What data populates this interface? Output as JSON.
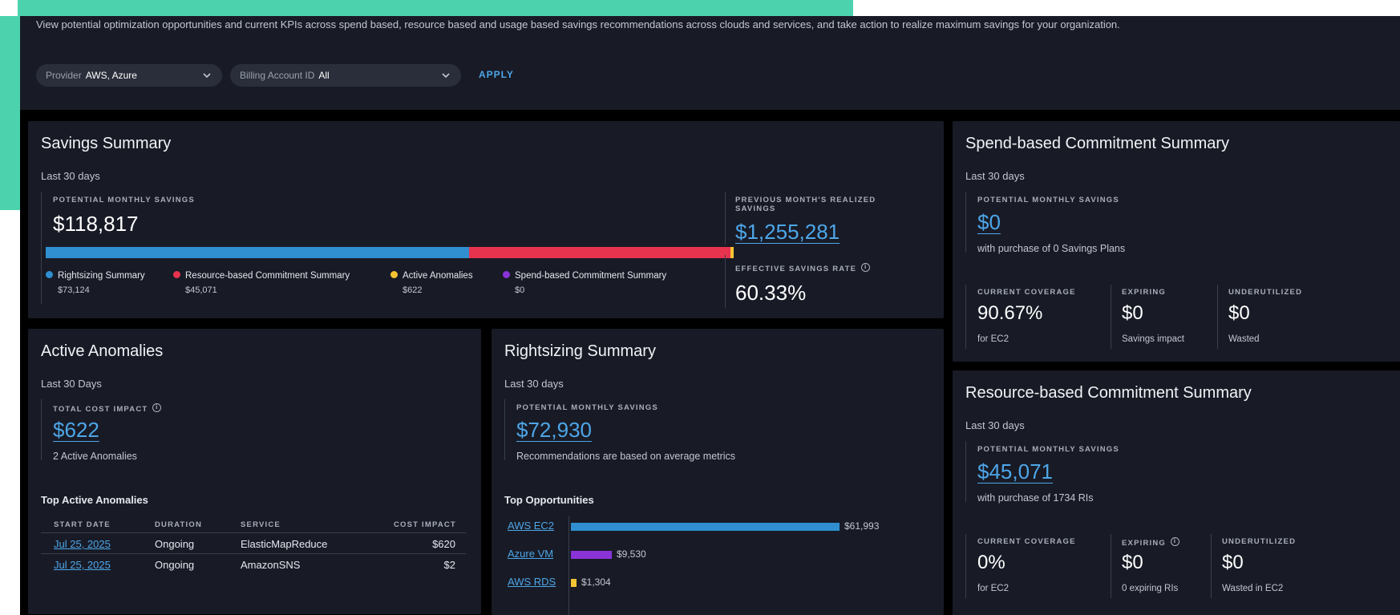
{
  "header": {
    "description": "View potential optimization opportunities and current KPIs across spend based, resource based and usage based savings recommendations across clouds and services, and take action to realize maximum savings for your organization.",
    "filters": [
      {
        "label": "Provider",
        "value": "AWS, Azure"
      },
      {
        "label": "Billing Account ID",
        "value": "All"
      }
    ],
    "apply_label": "APPLY"
  },
  "savings_summary": {
    "title": "Savings Summary",
    "period": "Last 30 days",
    "potential_label": "POTENTIAL MONTHLY SAVINGS",
    "potential_value": "$118,817",
    "breakdown_fractions": [
      0.614,
      0.379,
      0.005,
      0.0
    ],
    "legend": [
      {
        "label": "Rightsizing Summary",
        "value": "$73,124",
        "color": "#2f8fd0"
      },
      {
        "label": "Resource-based Commitment Summary",
        "value": "$45,071",
        "color": "#e8334f"
      },
      {
        "label": "Active Anomalies",
        "value": "$622",
        "color": "#f5c332"
      },
      {
        "label": "Spend-based Commitment Summary",
        "value": "$0",
        "color": "#8a33d6"
      }
    ],
    "previous_label": "PREVIOUS MONTH'S REALIZED SAVINGS",
    "previous_value": "$1,255,281",
    "rate_label": "EFFECTIVE SAVINGS RATE",
    "rate_value": "60.33%"
  },
  "spend_commitment": {
    "title": "Spend-based Commitment Summary",
    "period": "Last 30 days",
    "potential_label": "POTENTIAL MONTHLY SAVINGS",
    "potential_value": "$0",
    "potential_note": "with purchase of 0 Savings Plans",
    "coverage_label": "CURRENT COVERAGE",
    "coverage_value": "90.67%",
    "coverage_note": "for EC2",
    "expiring_label": "EXPIRING",
    "expiring_value": "$0",
    "expiring_note": "Savings impact",
    "under_label": "UNDERUTILIZED",
    "under_value": "$0",
    "under_note": "Wasted"
  },
  "anomalies": {
    "title": "Active Anomalies",
    "period": "Last 30 Days",
    "impact_label": "TOTAL COST IMPACT",
    "impact_value": "$622",
    "impact_note": "2 Active Anomalies",
    "top_label": "Top Active Anomalies",
    "columns": [
      "START DATE",
      "DURATION",
      "SERVICE",
      "COST IMPACT"
    ],
    "rows": [
      {
        "date": "Jul 25, 2025",
        "duration": "Ongoing",
        "service": "ElasticMapReduce",
        "impact": "$620"
      },
      {
        "date": "Jul 25, 2025",
        "duration": "Ongoing",
        "service": "AmazonSNS",
        "impact": "$2"
      }
    ]
  },
  "rightsizing": {
    "title": "Rightsizing Summary",
    "period": "Last 30 days",
    "potential_label": "POTENTIAL MONTHLY SAVINGS",
    "potential_value": "$72,930",
    "potential_note": "Recommendations are based on average metrics",
    "top_label": "Top Opportunities",
    "opportunities": [
      {
        "label": "AWS EC2",
        "value": "$61,993",
        "amount": 61993,
        "color": "#2f8fd0"
      },
      {
        "label": "Azure VM",
        "value": "$9,530",
        "amount": 9530,
        "color": "#8a33d6"
      },
      {
        "label": "AWS RDS",
        "value": "$1,304",
        "amount": 1304,
        "color": "#f5c332"
      }
    ]
  },
  "resource_commitment": {
    "title": "Resource-based Commitment Summary",
    "period": "Last 30 days",
    "potential_label": "POTENTIAL MONTHLY SAVINGS",
    "potential_value": "$45,071",
    "potential_note": "with purchase of 1734 RIs",
    "coverage_label": "CURRENT COVERAGE",
    "coverage_value": "0%",
    "coverage_note": "for EC2",
    "expiring_label": "EXPIRING",
    "expiring_value": "$0",
    "expiring_note": "0 expiring RIs",
    "under_label": "UNDERUTILIZED",
    "under_value": "$0",
    "under_note": "Wasted in EC2"
  }
}
